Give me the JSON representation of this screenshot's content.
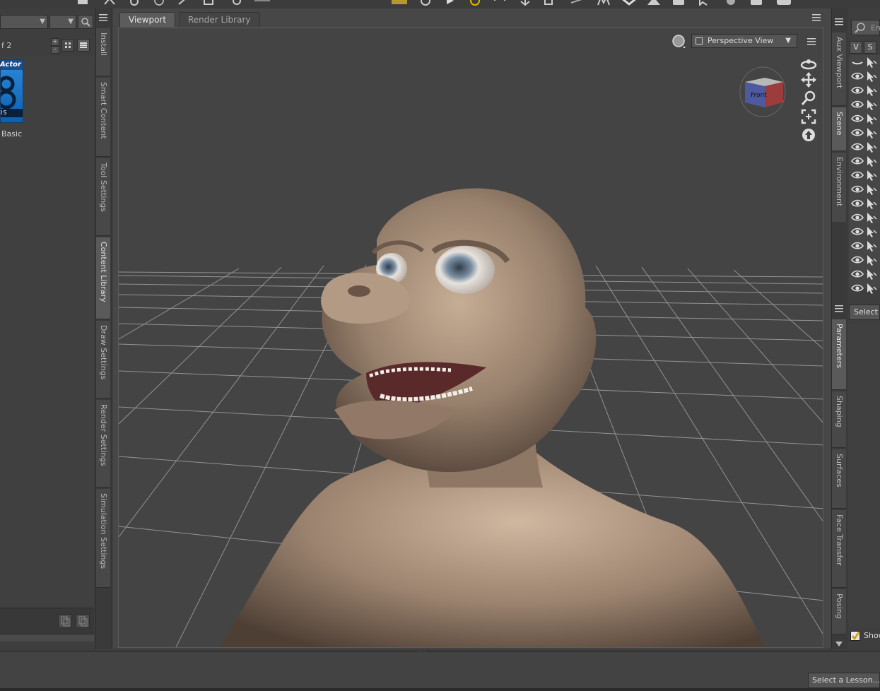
{
  "viewport_tabs": [
    {
      "label": "Viewport",
      "active": true
    },
    {
      "label": "Render Library",
      "active": false
    }
  ],
  "left_panel": {
    "page_label": "f 2",
    "thumbnail": {
      "badge_text": "Actor",
      "sub_text": "IS",
      "label": "Basic",
      "color": "#1f7ed0"
    }
  },
  "left_tabs": [
    "Install",
    "Smart Content",
    "Tool Settings",
    "Content Library",
    "Draw Settings",
    "Render Settings",
    "Simulation Settings"
  ],
  "left_active_tab": "Content Library",
  "viewport": {
    "view_mode": "Perspective View",
    "cube_label": "Front",
    "nav_icons": [
      "orbit-icon",
      "pan-icon",
      "zoom-icon",
      "frame-icon",
      "reset-view-icon"
    ],
    "background_color": "#444444",
    "grid_color": "#9a9a9a"
  },
  "right_tabs_top": [
    "Aux Viewport",
    "Scene",
    "Environment"
  ],
  "right_tabs_bottom": [
    "Parameters",
    "Shaping",
    "Surfaces",
    "Face Transfer",
    "Posing"
  ],
  "right_active_tabs": [
    "Scene",
    "Parameters"
  ],
  "scene_panel": {
    "search_placeholder": "En",
    "col_v": "V",
    "col_s": "S",
    "row_count": 17
  },
  "parameters_panel": {
    "select_label": "Select a",
    "show_label": "Show"
  },
  "lesson": {
    "label": "Select a Lesson..."
  }
}
